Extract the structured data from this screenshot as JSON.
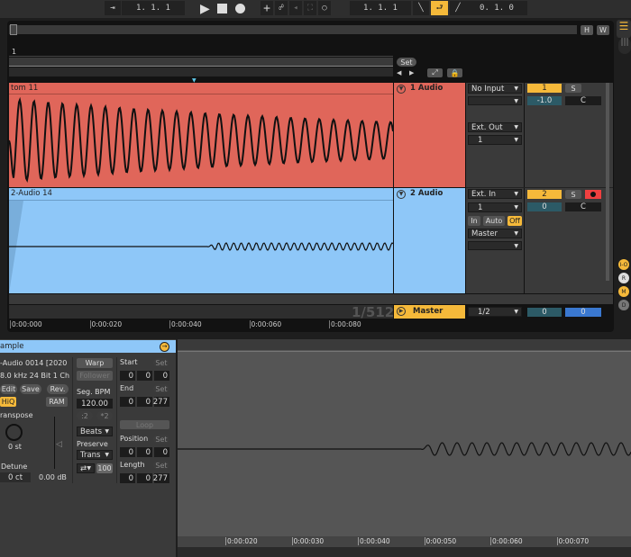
{
  "transport": {
    "follow_icon": "follow-arrow-icon",
    "arrangement_position": "1.  1.  1",
    "play_icon": "play-icon",
    "stop_icon": "stop-icon",
    "record_icon": "record-icon",
    "punch_in": "1.  1.  1",
    "loop_length": "0.  1.  0"
  },
  "overview": {
    "h_label": "H",
    "w_label": "W"
  },
  "arrangement": {
    "bar_marker": "1",
    "set_label": "Set",
    "zoom_readout": "1/512",
    "time_ticks": [
      "0:00:000",
      "0:00:020",
      "0:00:040",
      "0:00:060",
      "0:00:080"
    ]
  },
  "tracks": [
    {
      "clip_name": "tom 11",
      "name": "1 Audio",
      "color": "#e0665a",
      "input_type": "No Input",
      "output_type": "Ext. Out",
      "output_channel": "1",
      "number": "1",
      "solo": "S",
      "pan_value": "-1.0",
      "pan_center": "C"
    },
    {
      "clip_name": "2-Audio 14",
      "name": "2 Audio",
      "color": "#8ec7f8",
      "input_type": "Ext. In",
      "input_channel": "1",
      "monitor": [
        "In",
        "Auto",
        "Off"
      ],
      "output_type": "Master",
      "number": "2",
      "solo": "S",
      "pan_value": "0",
      "pan_center": "C"
    }
  ],
  "master": {
    "name": "Master",
    "output": "1/2",
    "volume": "0",
    "pan": "0"
  },
  "side_buttons": [
    "I-O",
    "R",
    "M",
    "D"
  ],
  "sample": {
    "title": "ample",
    "file": "-Audio 0014 [2020",
    "format": "8.0 kHz 24 Bit 1 Ch",
    "edit": "Edit",
    "save": "Save",
    "rev": "Rev.",
    "hiq": "HiQ",
    "ram": "RAM",
    "transpose_label": "ranspose",
    "transpose_value": "0 st",
    "detune_label": "Detune",
    "detune_value": "0 ct",
    "gain_value": "0.00 dB",
    "warp": "Warp",
    "follower": "Follower",
    "seg_bpm_label": "Seg. BPM",
    "seg_bpm": "120.00",
    "half": ":2",
    "double": "*2",
    "warp_mode": "Beats",
    "preserve_label": "Preserve",
    "preserve": "Trans",
    "envelope": "100",
    "start_label": "Start",
    "end_label": "End",
    "set": "Set",
    "start": [
      "0",
      "0",
      "0"
    ],
    "end": [
      "0",
      "0",
      "277"
    ],
    "loop": "Loop",
    "position_label": "Position",
    "position": [
      "0",
      "0",
      "0"
    ],
    "length_label": "Length",
    "length": [
      "0",
      "0",
      "277"
    ]
  },
  "sample_ruler": [
    "0:00:020",
    "0:00:030",
    "0:00:040",
    "0:00:050",
    "0:00:060",
    "0:00:070"
  ],
  "colors": {
    "accent": "#f5b93a",
    "track1": "#e0665a",
    "track2": "#8ec7f8",
    "record": "#f04040",
    "blue_pan": "#3a78d0"
  }
}
